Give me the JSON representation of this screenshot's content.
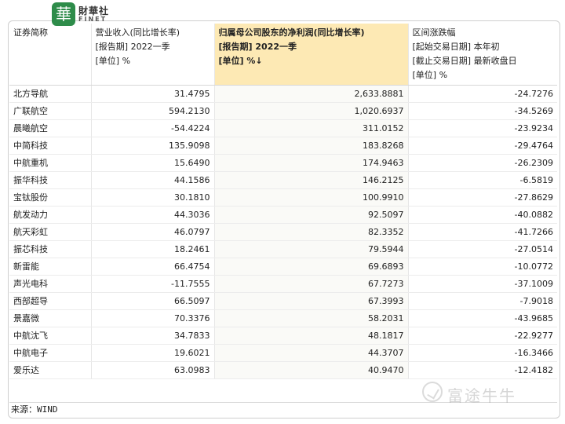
{
  "logo": {
    "badge_char": "華",
    "name_cn": "財華社",
    "name_en": "FINET"
  },
  "columns": [
    {
      "lines": [
        "证券简称"
      ]
    },
    {
      "lines": [
        "营业收入(同比增长率)",
        "[报告期] 2022一季",
        "[单位] %"
      ]
    },
    {
      "lines": [
        "归属母公司股东的净利润(同比增长率)",
        "[报告期] 2022一季",
        "[单位] %↓"
      ],
      "sorted": true
    },
    {
      "lines": [
        "区间涨跌幅",
        "[起始交易日期] 本年初",
        "[截止交易日期] 最新收盘日",
        "[单位] %"
      ]
    }
  ],
  "rows": [
    {
      "name": "北方导航",
      "revenue": "31.4795",
      "profit": "2,633.8881",
      "change": "-24.7276"
    },
    {
      "name": "广联航空",
      "revenue": "594.2130",
      "profit": "1,020.6937",
      "change": "-34.5269"
    },
    {
      "name": "晨曦航空",
      "revenue": "-54.4224",
      "profit": "311.0152",
      "change": "-23.9234"
    },
    {
      "name": "中简科技",
      "revenue": "135.9098",
      "profit": "183.8268",
      "change": "-29.4764"
    },
    {
      "name": "中航重机",
      "revenue": "15.6490",
      "profit": "174.9463",
      "change": "-26.2309"
    },
    {
      "name": "振华科技",
      "revenue": "44.1586",
      "profit": "146.2125",
      "change": "-6.5819"
    },
    {
      "name": "宝钛股份",
      "revenue": "30.1810",
      "profit": "100.9910",
      "change": "-27.8629"
    },
    {
      "name": "航发动力",
      "revenue": "44.3036",
      "profit": "92.5097",
      "change": "-40.0882"
    },
    {
      "name": "航天彩虹",
      "revenue": "46.0797",
      "profit": "82.3352",
      "change": "-41.7266"
    },
    {
      "name": "振芯科技",
      "revenue": "18.2461",
      "profit": "79.5944",
      "change": "-27.0514"
    },
    {
      "name": "新雷能",
      "revenue": "66.4754",
      "profit": "69.6893",
      "change": "-10.0772"
    },
    {
      "name": "声光电科",
      "revenue": "-11.7555",
      "profit": "67.7273",
      "change": "-37.1009"
    },
    {
      "name": "西部超导",
      "revenue": "66.5097",
      "profit": "67.3993",
      "change": "-7.9018"
    },
    {
      "name": "景嘉微",
      "revenue": "70.3376",
      "profit": "58.2031",
      "change": "-43.9685"
    },
    {
      "name": "中航沈飞",
      "revenue": "34.7833",
      "profit": "48.1817",
      "change": "-22.9277"
    },
    {
      "name": "中航电子",
      "revenue": "19.6021",
      "profit": "44.3707",
      "change": "-16.3466"
    },
    {
      "name": "爱乐达",
      "revenue": "63.0983",
      "profit": "40.9470",
      "change": "-12.4182"
    }
  ],
  "source": "来源：WIND",
  "watermark": "富途牛牛",
  "colors": {
    "sorted_header_bg": "#fde9b4",
    "logo_green": "#2e8c4a"
  }
}
